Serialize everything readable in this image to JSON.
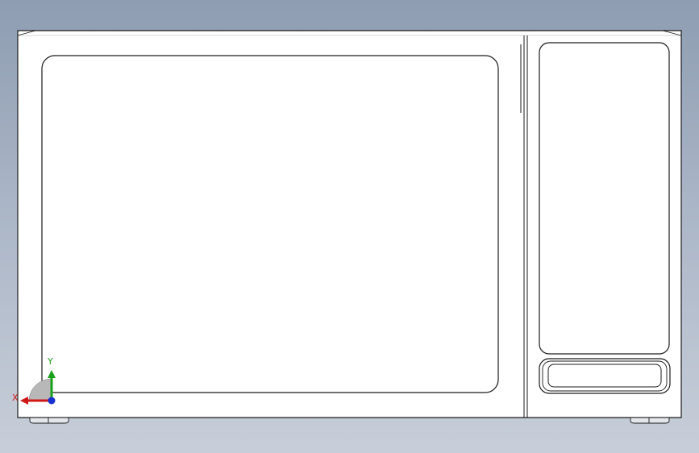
{
  "view": {
    "background_top": "#8e9db2",
    "background_bottom": "#c7ced9",
    "line_color": "#1a1a1a",
    "body_fill": "#ffffff"
  },
  "triad": {
    "x_label": "X",
    "y_label": "Y",
    "x_color": "#d01818",
    "y_color": "#1aa01a",
    "z_color": "#1a2fd0"
  }
}
